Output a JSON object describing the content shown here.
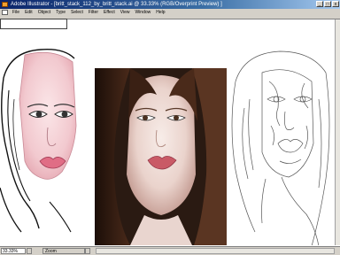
{
  "window": {
    "title": "Adobe Illustrator - [britt_stack_112_by_britt_stack.ai @ 33.33% (RGB/Overprint Preview) ]",
    "minimize": "_",
    "maximize": "□",
    "close": "x"
  },
  "menubar": {
    "items": [
      "File",
      "Edit",
      "Object",
      "Type",
      "Select",
      "Filter",
      "Effect",
      "View",
      "Window",
      "Help"
    ]
  },
  "statusbar": {
    "zoom": "33.33%",
    "status": "Zoom"
  },
  "artwork": {
    "left": "colored-vector-face-illustration",
    "center": "reference-photo",
    "right": "outline-line-art"
  }
}
